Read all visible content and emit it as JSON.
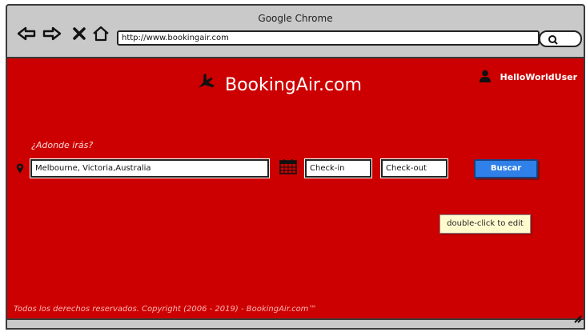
{
  "browser": {
    "title": "Google Chrome",
    "url": "http://www.bookingair.com",
    "icons": [
      "back-arrow-icon",
      "forward-arrow-icon",
      "close-icon",
      "home-icon",
      "search-icon"
    ]
  },
  "header": {
    "brand": "BookingAir.com",
    "brand_icon": "airplane-icon",
    "user_icon": "user-icon",
    "username": "HelloWorldUser"
  },
  "search": {
    "where_label": "¿Adonde irás?",
    "destination_value": "Melbourne, Victoria,Australia",
    "checkin_value": "Check-in",
    "checkout_value": "Check-out",
    "button_label": "Buscar",
    "pin_icon": "map-pin-icon",
    "calendar_icon": "calendar-icon"
  },
  "tooltip": "double-click to edit",
  "footer": "Todos los derechos reservados. Copyright (2006 - 2019) - BookingAir.com™",
  "colors": {
    "background": "#cc0000",
    "button": "#2f80e8",
    "tooltip": "#fffbcf"
  }
}
